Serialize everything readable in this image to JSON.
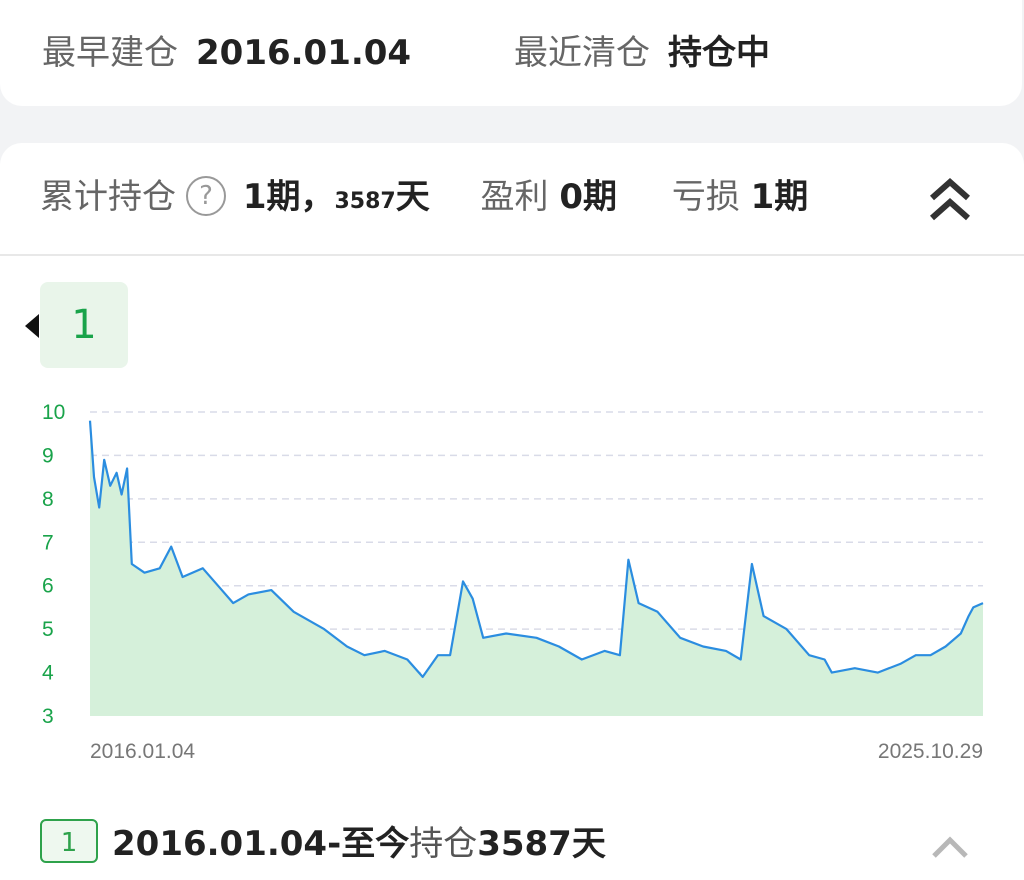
{
  "top": {
    "earliest_label": "最早建仓",
    "earliest_value": "2016.01.04",
    "recent_label": "最近清仓",
    "recent_value": "持仓中"
  },
  "summary": {
    "label": "累计持仓",
    "help_icon": "question-circle-icon",
    "periods": "1期，",
    "days": "3587",
    "days_unit": "天",
    "profit_label": "盈利",
    "profit_value": "0期",
    "loss_label": "亏损",
    "loss_value": "1期",
    "collapse_icon": "double-chevron-up-icon"
  },
  "period_tag": "1",
  "colors": {
    "accent": "#19a34a",
    "line": "#2b8de0",
    "fill": "#d5f0da",
    "grid": "#d9dbe8"
  },
  "chart_data": {
    "type": "area",
    "ylim": [
      3,
      10
    ],
    "yticks": [
      "10",
      "9",
      "8",
      "7",
      "6",
      "5",
      "4",
      "3"
    ],
    "x_start_label": "2016.01.04",
    "x_end_label": "2025.10.29",
    "series": [
      {
        "points": [
          [
            "2016.01.04",
            9.8
          ],
          [
            "2016.01.20",
            8.5
          ],
          [
            "2016.02.10",
            7.8
          ],
          [
            "2016.03.01",
            8.9
          ],
          [
            "2016.03.25",
            8.3
          ],
          [
            "2016.04.20",
            8.6
          ],
          [
            "2016.05.10",
            8.1
          ],
          [
            "2016.06.01",
            8.7
          ],
          [
            "2016.06.20",
            6.5
          ],
          [
            "2016.08.10",
            6.3
          ],
          [
            "2016.10.10",
            6.4
          ],
          [
            "2016.11.25",
            6.9
          ],
          [
            "2017.01.10",
            6.2
          ],
          [
            "2017.04.01",
            6.4
          ],
          [
            "2017.06.01",
            6.0
          ],
          [
            "2017.08.01",
            5.6
          ],
          [
            "2017.10.01",
            5.8
          ],
          [
            "2018.01.01",
            5.9
          ],
          [
            "2018.04.01",
            5.4
          ],
          [
            "2018.08.01",
            5.0
          ],
          [
            "2018.11.01",
            4.6
          ],
          [
            "2019.01.10",
            4.4
          ],
          [
            "2019.04.01",
            4.5
          ],
          [
            "2019.07.01",
            4.3
          ],
          [
            "2019.09.01",
            3.9
          ],
          [
            "2019.11.01",
            4.4
          ],
          [
            "2019.12.20",
            4.4
          ],
          [
            "2020.02.10",
            6.1
          ],
          [
            "2020.03.20",
            5.7
          ],
          [
            "2020.05.01",
            4.8
          ],
          [
            "2020.08.01",
            4.9
          ],
          [
            "2020.12.01",
            4.8
          ],
          [
            "2021.03.01",
            4.6
          ],
          [
            "2021.06.01",
            4.3
          ],
          [
            "2021.09.01",
            4.5
          ],
          [
            "2021.11.01",
            4.4
          ],
          [
            "2021.12.05",
            6.6
          ],
          [
            "2022.01.15",
            5.6
          ],
          [
            "2022.04.01",
            5.4
          ],
          [
            "2022.07.01",
            4.8
          ],
          [
            "2022.10.01",
            4.6
          ],
          [
            "2023.01.01",
            4.5
          ],
          [
            "2023.03.01",
            4.3
          ],
          [
            "2023.04.15",
            6.5
          ],
          [
            "2023.06.01",
            5.3
          ],
          [
            "2023.09.01",
            5.0
          ],
          [
            "2023.12.01",
            4.4
          ],
          [
            "2024.02.01",
            4.3
          ],
          [
            "2024.03.01",
            4.0
          ],
          [
            "2024.06.01",
            4.1
          ],
          [
            "2024.09.01",
            4.0
          ],
          [
            "2024.12.01",
            4.2
          ],
          [
            "2025.02.01",
            4.4
          ],
          [
            "2025.04.01",
            4.4
          ],
          [
            "2025.06.01",
            4.6
          ],
          [
            "2025.08.01",
            4.9
          ],
          [
            "2025.09.01",
            5.3
          ],
          [
            "2025.09.20",
            5.5
          ],
          [
            "2025.10.29",
            5.6
          ]
        ]
      }
    ]
  },
  "bottom": {
    "badge": "1",
    "period_dates": "2016.01.04-至今",
    "period_hold": "持仓",
    "period_days": "3587天",
    "expand_icon": "chevron-up-icon"
  }
}
